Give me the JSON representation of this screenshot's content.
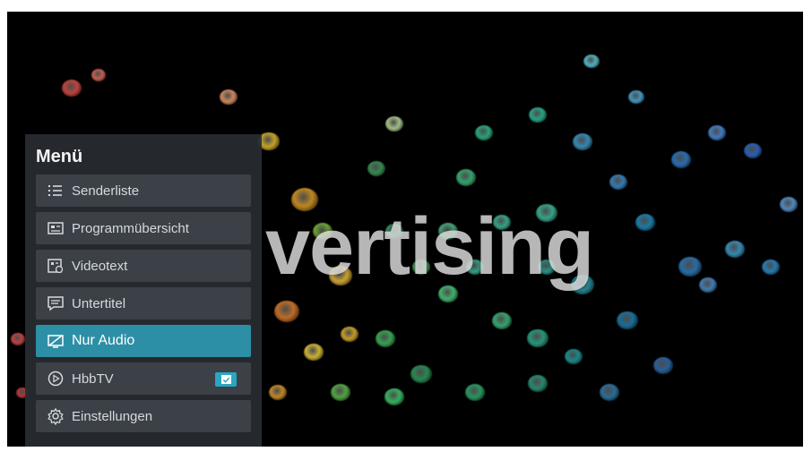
{
  "background": {
    "overlay_text": "vertising"
  },
  "menu": {
    "title": "Menü",
    "items": [
      {
        "label": "Senderliste",
        "icon": "list-icon"
      },
      {
        "label": "Programmübersicht",
        "icon": "guide-icon"
      },
      {
        "label": "Videotext",
        "icon": "teletext-icon"
      },
      {
        "label": "Untertitel",
        "icon": "subtitles-icon"
      },
      {
        "label": "Nur Audio",
        "icon": "audio-only-icon",
        "selected": true
      },
      {
        "label": "HbbTV",
        "icon": "hbbtv-icon",
        "toggle_checked": true
      },
      {
        "label": "Einstellungen",
        "icon": "gear-icon"
      }
    ]
  },
  "colors": {
    "accent": "#2d8fa6",
    "toggle": "#2aa6c2",
    "menu_bg": "#282c32",
    "item_bg": "#3c4148"
  }
}
